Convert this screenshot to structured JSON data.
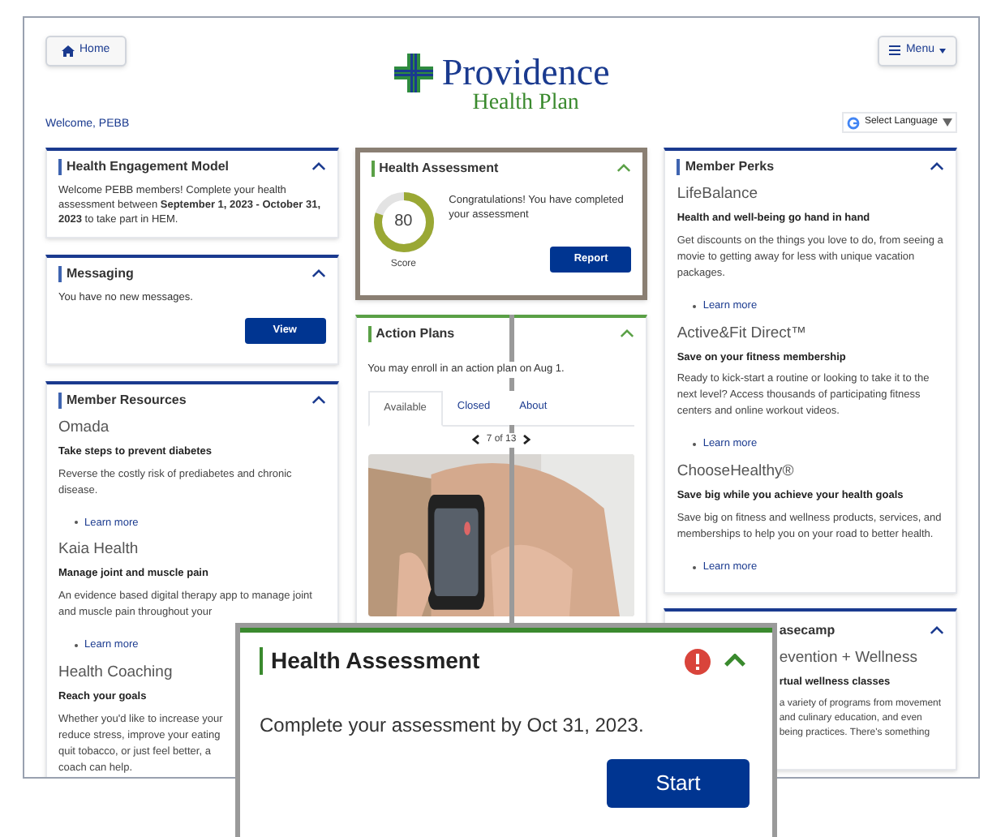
{
  "header": {
    "home_button": "Home",
    "logo_name": "Providence",
    "logo_subtitle": "Health Plan",
    "menu_button": "Menu",
    "welcome": "Welcome, PEBB",
    "language_select": "Select Language"
  },
  "health_engagement_model": {
    "title": "Health Engagement Model",
    "expanded": true,
    "text": "Welcome PEBB members! Complete your health assessment between **September 1, 2023 - October 31, 2023** to take part in HEM."
  },
  "messaging": {
    "title": "Messaging",
    "expanded": true,
    "text": "You have no new messages.",
    "button": "View"
  },
  "member_resources": {
    "title": "Member Resources",
    "expanded": true,
    "items": [
      {
        "name": "Omada",
        "tagline": "Take steps to prevent diabetes",
        "lines": [
          "Reverse the costly risk of prediabetes and chronic disease."
        ],
        "link": "Learn more"
      },
      {
        "name": "Kaia Health",
        "tagline": "Manage joint and muscle pain",
        "lines": [
          "An evidence based digital therapy app to manage joint",
          "and muscle pain throughout your"
        ],
        "link": "Learn more"
      },
      {
        "name": "Health Coaching",
        "tagline": "Reach your goals",
        "lines": [
          "Whether you'd like to increase your",
          "reduce stress, improve your eating",
          "quit tobacco, or just feel better, a",
          "coach can help."
        ]
      }
    ]
  },
  "health_assessment": {
    "title": "Health Assessment",
    "expanded": true,
    "highlighted": true,
    "score": "80",
    "level": 0.8,
    "score_label": "Score",
    "message": "Congratulations! You have completed your assessment",
    "button": "Report"
  },
  "action_plans": {
    "title": "Action Plans",
    "expanded": true,
    "message": "You may enroll in an action plan on Aug 1.",
    "tabs": [
      {
        "label": "Available",
        "selected": true
      },
      {
        "label": "Closed",
        "selected": false
      },
      {
        "label": "About",
        "selected": false
      }
    ],
    "pager": "7 of 13"
  },
  "member_perks": {
    "title": "Member Perks",
    "expanded": true,
    "items": [
      {
        "name": "LifeBalance",
        "tagline": "Health and well-being go hand in hand",
        "lines": [
          "Get discounts on the things you love to do, from seeing a movie to getting away for less with unique vacation packages."
        ],
        "link": "Learn more"
      },
      {
        "name": "Active&Fit Direct™",
        "tagline": "Save on your fitness membership",
        "lines": [
          "Ready to kick-start a routine or looking to take it to the next level? Access thousands of participating fitness centers and online workout videos."
        ],
        "link": "Learn more"
      },
      {
        "name": "ChooseHealthy®",
        "tagline": "Save big while you achieve your health goals",
        "lines": [
          "Save big on fitness and wellness products, services, and memberships to help you on your road to better health."
        ],
        "link": "Learn more"
      }
    ]
  },
  "basecamp": {
    "title": "asecamp",
    "expanded": true,
    "program": "evention + Wellness",
    "tagline": "rtual wellness classes",
    "lines": [
      "a variety of programs from movement",
      "and culinary education, and even",
      "being practices. There's something"
    ]
  },
  "callout": {
    "title": "Health Assessment",
    "alert": true,
    "expanded": true,
    "message": "Complete your assessment by Oct 31, 2023.",
    "button": "Start"
  }
}
